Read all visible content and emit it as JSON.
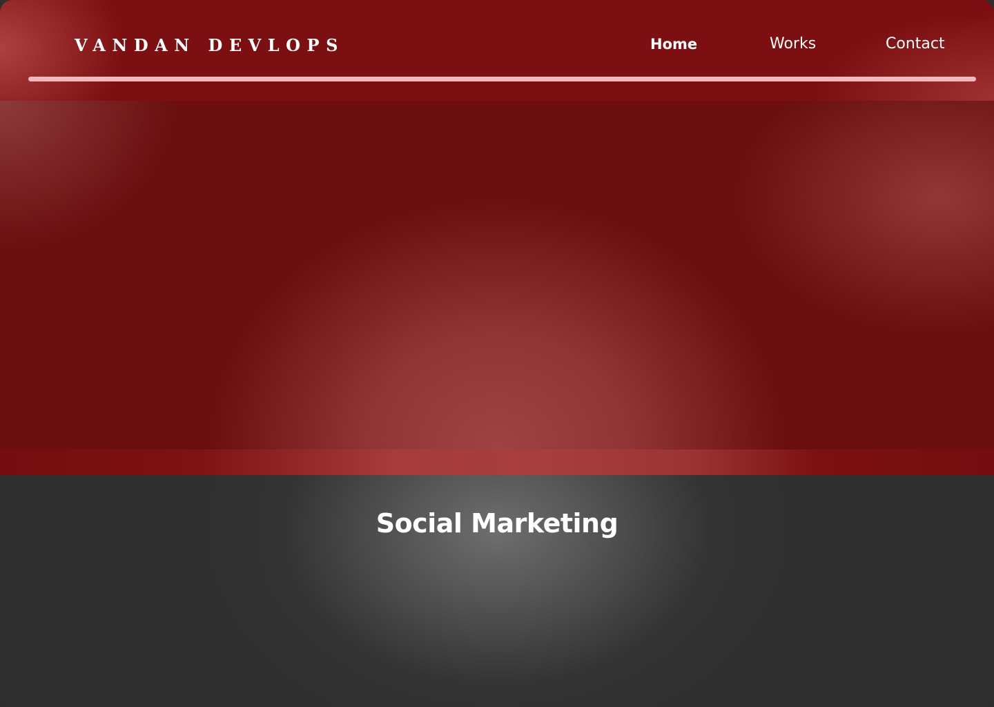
{
  "header": {
    "brand": "VANDAN DEVLOPS",
    "nav": {
      "home": "Home",
      "works": "Works",
      "contact": "Contact"
    }
  },
  "section": {
    "title": "Social Marketing"
  },
  "colors": {
    "header_bg": "#7c0f11",
    "hero_bg": "#6a0e0f",
    "accent_rule": "#f0b9bb",
    "section_bg": "#303030",
    "text": "#ffffff"
  }
}
